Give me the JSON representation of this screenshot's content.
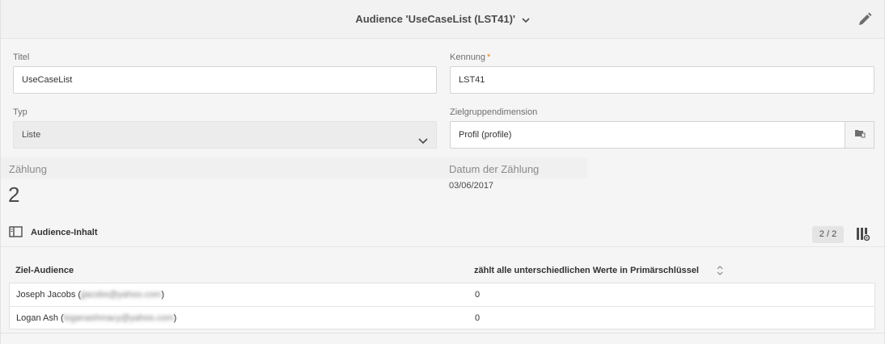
{
  "header": {
    "title": "Audience 'UseCaseList (LST41)'"
  },
  "form": {
    "title_label": "Titel",
    "title_value": "UseCaseList",
    "id_label": "Kennung",
    "id_required": "*",
    "id_value": "LST41",
    "type_label": "Typ",
    "type_value": "Liste",
    "dimension_label": "Zielgruppendimension",
    "dimension_value": "Profil (profile)"
  },
  "stats": {
    "count_label": "Zählung",
    "count_value": "2",
    "date_label": "Datum der Zählung",
    "date_value": "03/06/2017"
  },
  "content": {
    "title": "Audience-Inhalt",
    "counter": "2 / 2",
    "columns": [
      "Ziel-Audience",
      "zählt alle unterschiedlichen Werte in Primärschlüssel"
    ],
    "rows": [
      {
        "name": "Joseph Jacobs (",
        "email": "jjacobs@yahoo.com",
        "close": ")",
        "value": "0"
      },
      {
        "name": "Logan Ash (",
        "email": "loganashmacy@yahoo.com",
        "close": ")",
        "value": "0"
      }
    ]
  },
  "colors": {
    "required": "#e68619",
    "accent_text": "#323232"
  },
  "icons": [
    "chevron-down-icon",
    "edit-pencil-icon",
    "folder-picker-icon",
    "panel-icon",
    "column-settings-icon",
    "sort-icon"
  ]
}
